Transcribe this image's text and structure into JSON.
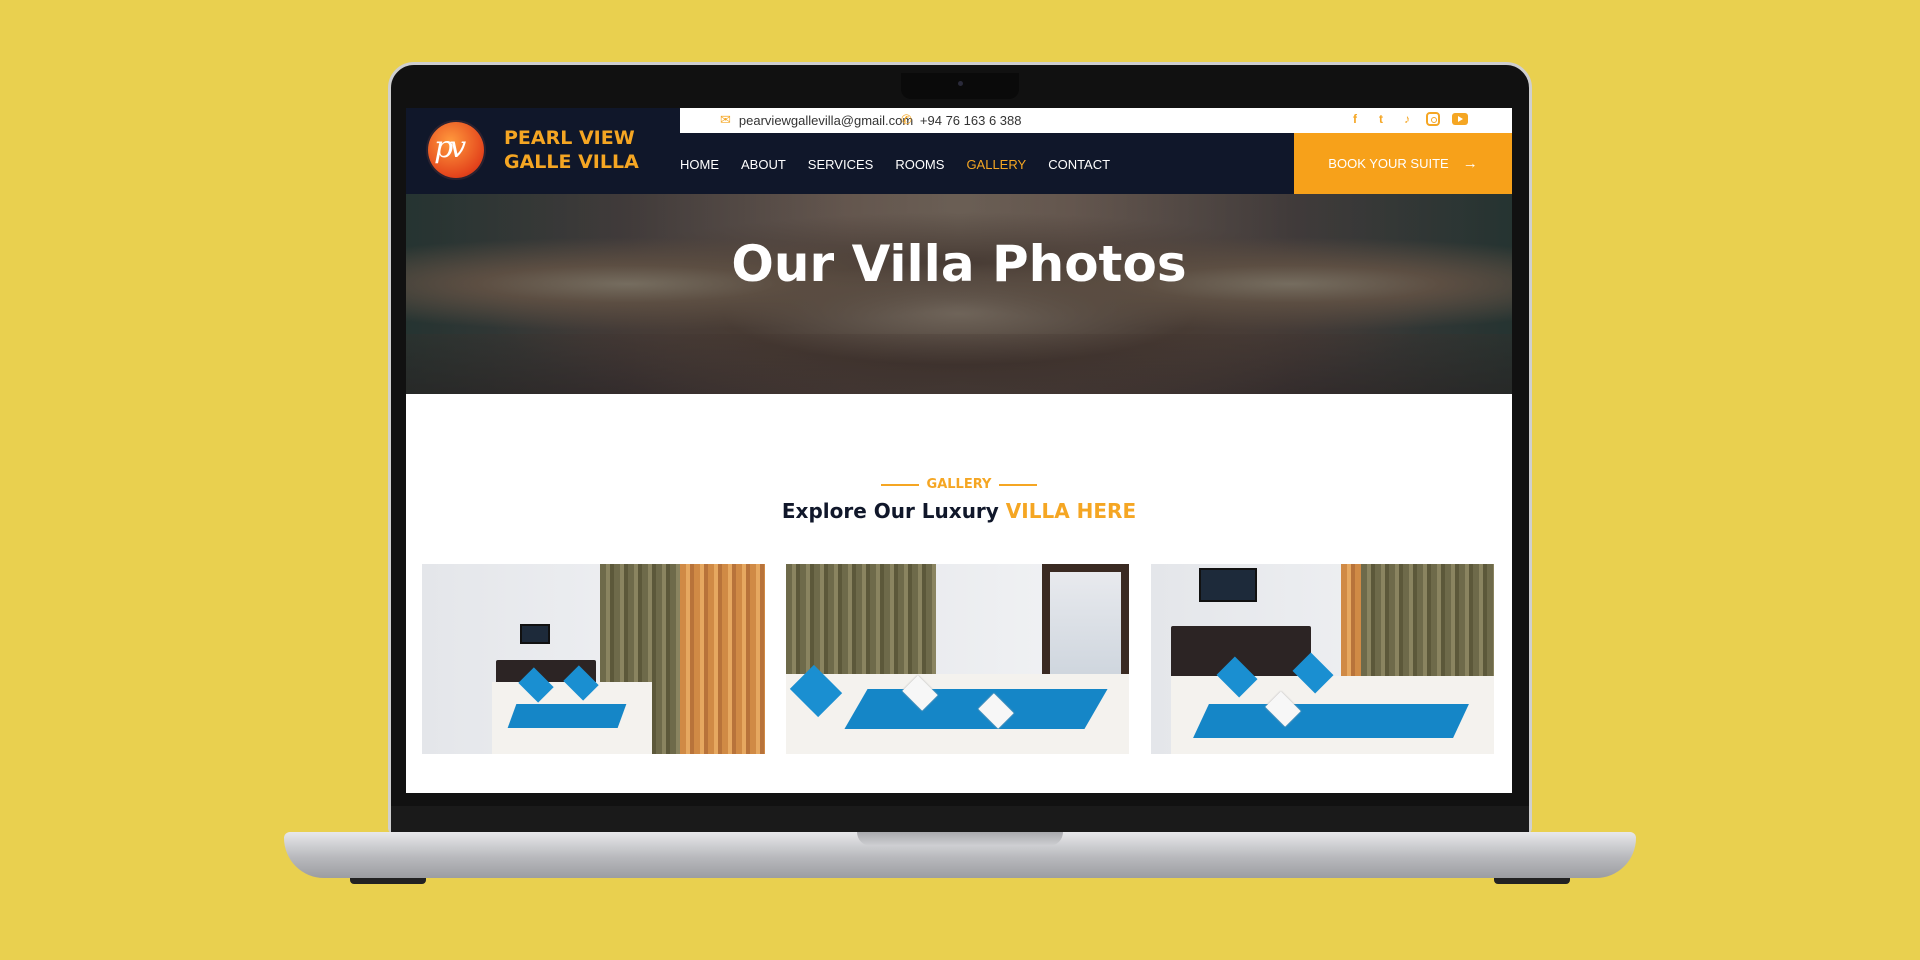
{
  "brand": {
    "name_line1": "PEARL VIEW",
    "name_line2": "GALLE VILLA",
    "logo_mark": "pv"
  },
  "topbar": {
    "email": "pearviewgallevilla@gmail.com",
    "phone": "+94 76 163 6 388",
    "socials": [
      "facebook-icon",
      "twitter-icon",
      "tiktok-icon",
      "instagram-icon",
      "youtube-icon"
    ]
  },
  "nav": {
    "items": [
      "HOME",
      "ABOUT",
      "SERVICES",
      "ROOMS",
      "GALLERY",
      "CONTACT"
    ],
    "active": "GALLERY"
  },
  "cta": {
    "label": "BOOK YOUR SUITE"
  },
  "hero": {
    "title": "Our Villa Photos"
  },
  "gallery_section": {
    "tag": "GALLERY",
    "title_prefix": "Explore Our Luxury",
    "title_highlight": "VILLA HERE"
  },
  "colors": {
    "accent": "#f5a623",
    "navy": "#10172a",
    "background": "#e9d04f",
    "bedding_blue": "#1586c7"
  }
}
